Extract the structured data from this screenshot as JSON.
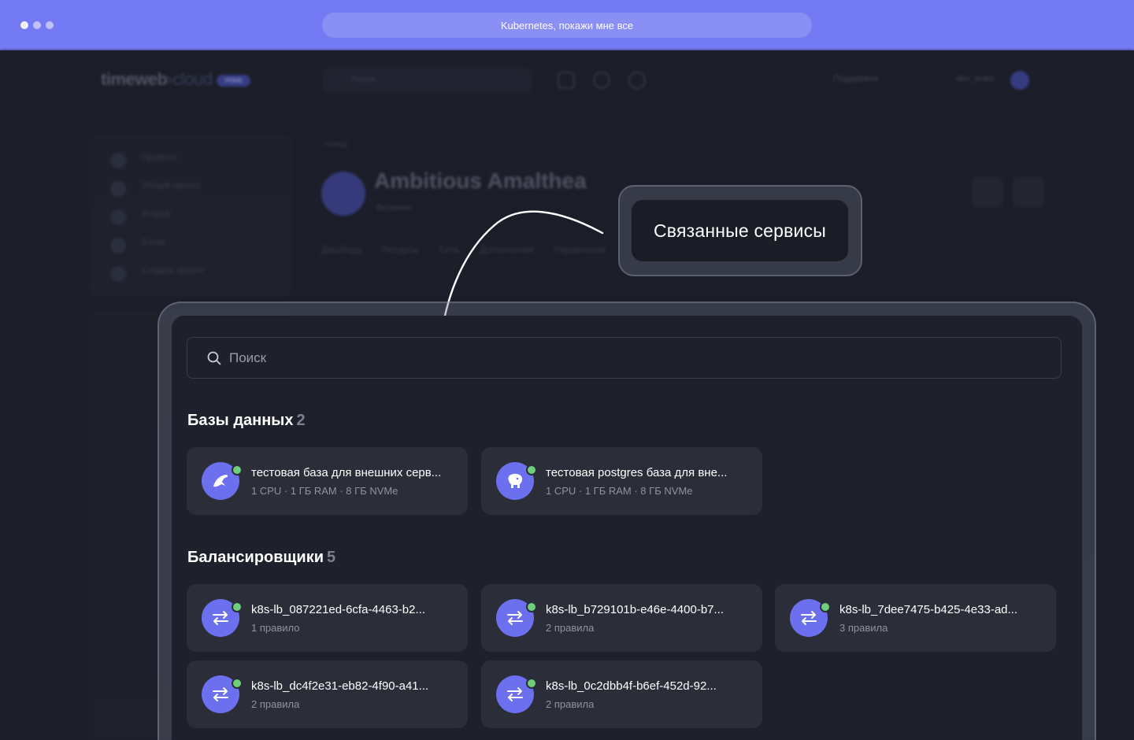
{
  "browser": {
    "address": "Kubernetes, покажи мне все"
  },
  "background_app": {
    "logo_main": "timeweb",
    "logo_cloud": "cloud",
    "logo_badge": "PRIME",
    "search_placeholder": "Поиск",
    "support": "Поддержка",
    "user": "dev_team",
    "sidebar_items": [
      "Проекты",
      "Общий проект",
      "Второй",
      "Бэкап",
      "Создать проект"
    ],
    "breadcrumb": "Назад",
    "title": "Ambitious Amalthea",
    "status": "Включен",
    "tabs": [
      "Дашборд",
      "Ресурсы",
      "Сеть",
      "Дополнения",
      "Управление"
    ]
  },
  "callout": {
    "label": "Связанные сервисы"
  },
  "search": {
    "placeholder": "Поиск"
  },
  "databases": {
    "title": "Базы данных",
    "count": "2",
    "items": [
      {
        "name": "тестовая база для внешних серв...",
        "spec": "1 CPU · 1 ГБ RAM · 8 ГБ NVMe",
        "icon": "mysql-dolphin-icon",
        "status_color": "#6fcf7a"
      },
      {
        "name": "тестовая postgres база для вне...",
        "spec": "1 CPU · 1 ГБ RAM · 8 ГБ NVMe",
        "icon": "postgres-elephant-icon",
        "status_color": "#6fcf7a"
      }
    ]
  },
  "balancers": {
    "title": "Балансировщики",
    "count": "5",
    "items": [
      {
        "name": "k8s-lb_087221ed-6cfa-4463-b2...",
        "rules": "1 правило",
        "icon": "swap-arrows-icon"
      },
      {
        "name": "k8s-lb_b729101b-e46e-4400-b7...",
        "rules": "2 правила",
        "icon": "swap-arrows-icon"
      },
      {
        "name": "k8s-lb_7dee7475-b425-4e33-ad...",
        "rules": "3 правила",
        "icon": "swap-arrows-icon"
      },
      {
        "name": "k8s-lb_dc4f2e31-eb82-4f90-a41...",
        "rules": "2 правила",
        "icon": "swap-arrows-icon"
      },
      {
        "name": "k8s-lb_0c2dbb4f-b6ef-452d-92...",
        "rules": "2 правила",
        "icon": "swap-arrows-icon"
      }
    ]
  },
  "colors": {
    "accent": "#7479f4",
    "icon_bg": "#6c70ef",
    "status_online": "#6fcf7a",
    "card_bg": "#2b2e39",
    "panel_bg": "#1e212b"
  }
}
